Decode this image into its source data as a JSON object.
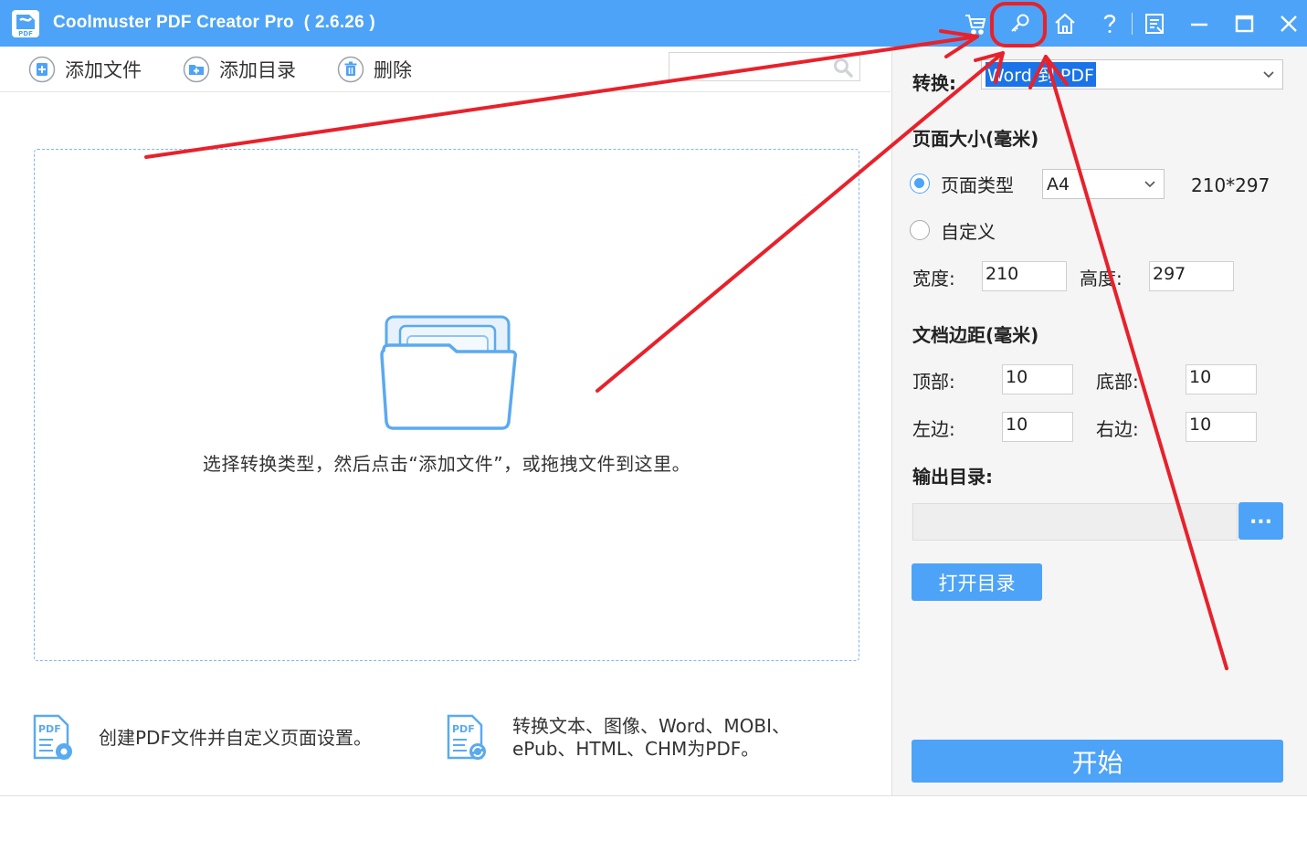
{
  "window": {
    "title": "Coolmuster PDF Creator Pro  ( 2.6.26 )",
    "logo_text": "PDF",
    "accent": "#4da3f7",
    "controls": [
      "cart-icon",
      "key-icon",
      "home-icon",
      "help-icon",
      "feedback-icon",
      "minimize-icon",
      "maximize-icon",
      "close-icon"
    ]
  },
  "toolbar": {
    "add_file": "添加文件",
    "add_folder": "添加目录",
    "delete": "删除",
    "search_placeholder": ""
  },
  "dropzone": {
    "hint": "选择转换类型，然后点击“添加文件”，或拖拽文件到这里。"
  },
  "features": [
    {
      "text_line1": "创建PDF文件并自定义页面设置。",
      "text_line2": "",
      "icon": "pdf-settings-icon"
    },
    {
      "text_line1": "转换文本、图像、Word、MOBI、",
      "text_line2": "ePub、HTML、CHM为PDF。",
      "icon": "pdf-convert-icon"
    }
  ],
  "sidebar": {
    "convert_label": "转换:",
    "convert_value": "Word 到 PDF",
    "page_size_heading": "页面大小(毫米)",
    "page_type_label": "页面类型",
    "page_type_value": "A4",
    "page_dims": "210*297",
    "custom_label": "自定义",
    "width_label": "宽度:",
    "width_value": "210",
    "height_label": "高度:",
    "height_value": "297",
    "margin_heading": "文档边距(毫米)",
    "top_label": "顶部:",
    "top_value": "10",
    "bottom_label": "底部:",
    "bottom_value": "10",
    "left_label": "左边:",
    "left_value": "10",
    "right_label": "右边:",
    "right_value": "10",
    "output_heading": "输出目录:",
    "output_path": "",
    "browse_label": "...",
    "open_dir_label": "打开目录",
    "start_label": "开始"
  },
  "annotation": {
    "color": "#e8212b",
    "highlighted": "key-icon"
  }
}
